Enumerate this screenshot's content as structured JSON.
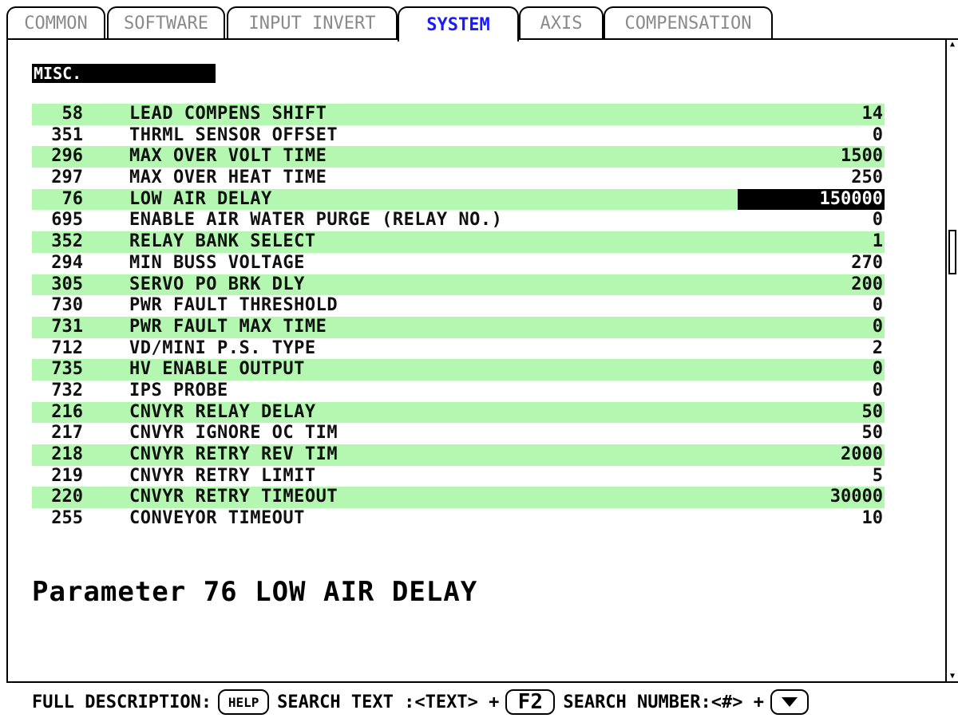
{
  "tabs": [
    {
      "label": "COMMON",
      "active": false
    },
    {
      "label": "SOFTWARE",
      "active": false
    },
    {
      "label": "INPUT INVERT",
      "active": false
    },
    {
      "label": "SYSTEM",
      "active": true
    },
    {
      "label": "AXIS",
      "active": false
    },
    {
      "label": "COMPENSATION",
      "active": false
    }
  ],
  "section_label": "MISC.",
  "parameters": [
    {
      "num": "58",
      "name": "LEAD COMPENS SHIFT",
      "value": "14"
    },
    {
      "num": "351",
      "name": "THRML SENSOR OFFSET",
      "value": "0"
    },
    {
      "num": "296",
      "name": "MAX OVER VOLT TIME",
      "value": "1500"
    },
    {
      "num": "297",
      "name": "MAX OVER HEAT TIME",
      "value": "250"
    },
    {
      "num": "76",
      "name": "LOW AIR DELAY",
      "value": "150000",
      "selected": true
    },
    {
      "num": "695",
      "name": "ENABLE AIR WATER PURGE (RELAY NO.)",
      "value": "0"
    },
    {
      "num": "352",
      "name": "RELAY BANK SELECT",
      "value": "1"
    },
    {
      "num": "294",
      "name": "MIN BUSS VOLTAGE",
      "value": "270"
    },
    {
      "num": "305",
      "name": "SERVO PO BRK DLY",
      "value": "200"
    },
    {
      "num": "730",
      "name": "PWR FAULT THRESHOLD",
      "value": "0"
    },
    {
      "num": "731",
      "name": "PWR FAULT MAX TIME",
      "value": "0"
    },
    {
      "num": "712",
      "name": "VD/MINI P.S. TYPE",
      "value": "2"
    },
    {
      "num": "735",
      "name": "HV ENABLE OUTPUT",
      "value": "0"
    },
    {
      "num": "732",
      "name": "IPS PROBE",
      "value": "0"
    },
    {
      "num": "216",
      "name": "CNVYR RELAY DELAY",
      "value": "50"
    },
    {
      "num": "217",
      "name": "CNVYR IGNORE OC TIM",
      "value": "50"
    },
    {
      "num": "218",
      "name": "CNVYR RETRY REV TIM",
      "value": "2000"
    },
    {
      "num": "219",
      "name": "CNVYR RETRY LIMIT",
      "value": "5"
    },
    {
      "num": "220",
      "name": "CNVYR RETRY TIMEOUT",
      "value": "30000"
    },
    {
      "num": "255",
      "name": "CONVEYOR TIMEOUT",
      "value": "10"
    }
  ],
  "description": "Parameter 76 LOW AIR DELAY",
  "footer": {
    "full_desc_label": "FULL DESCRIPTION:",
    "help_key": "HELP",
    "search_text_label": "SEARCH TEXT :<TEXT> +",
    "f2_key": "F2",
    "search_number_label": "SEARCH NUMBER:<#> +",
    "down_key_icon": "down-arrow-icon"
  },
  "colors": {
    "row_highlight": "#b4f7b0",
    "active_tab": "#1a1aff",
    "inactive_tab": "#8a8a8a"
  }
}
